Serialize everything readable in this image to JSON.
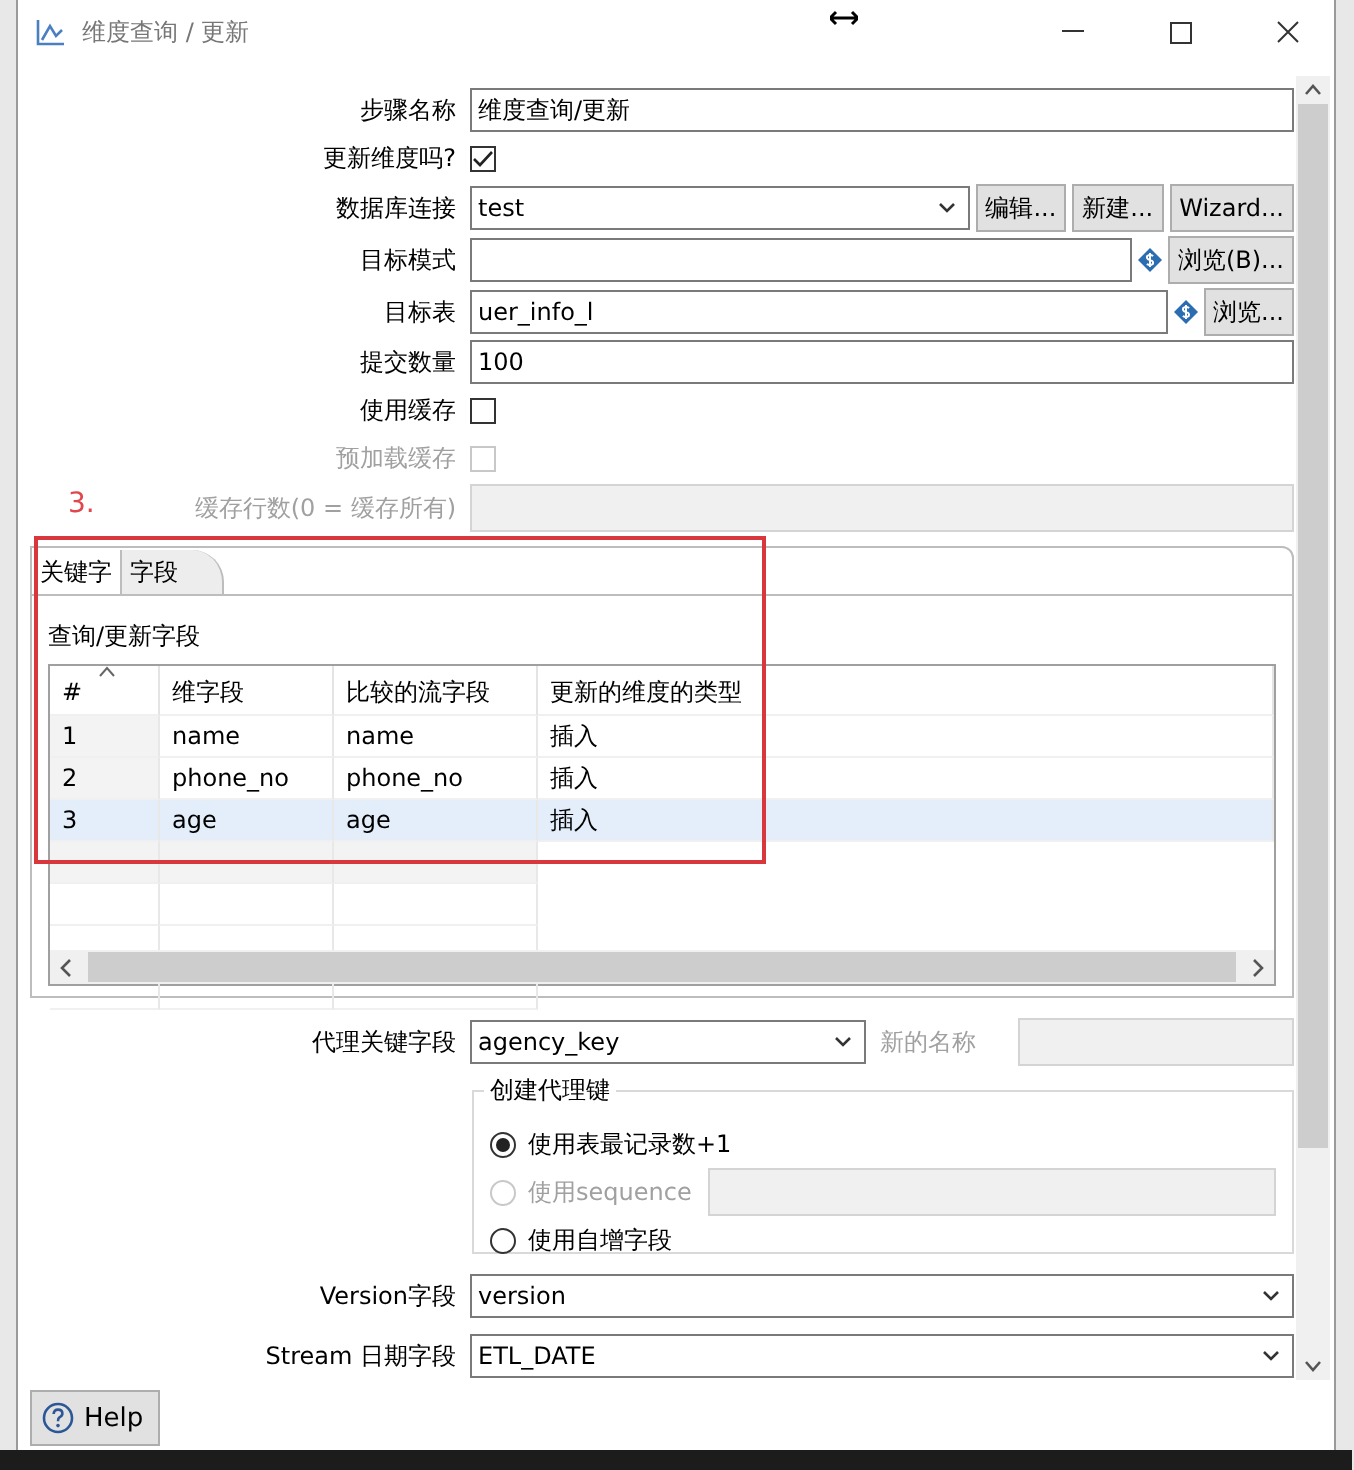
{
  "window": {
    "title": "维度查询 / 更新"
  },
  "annotation": "3.",
  "fields": [
    {
      "kind": "text",
      "label": "步骤名称",
      "value": "维度查询/更新"
    },
    {
      "kind": "checkbox",
      "label": "更新维度吗?",
      "checked": true,
      "disabled": false
    },
    {
      "kind": "combo",
      "label": "数据库连接",
      "value": "test",
      "buttons": [
        "编辑...",
        "新建...",
        "Wizard..."
      ]
    },
    {
      "kind": "text",
      "label": "目标模式",
      "variable": true,
      "buttons": [
        "浏览(B)..."
      ]
    },
    {
      "kind": "text",
      "label": "目标表",
      "value": "uer_info_l",
      "variable": true,
      "buttons": [
        "浏览..."
      ]
    },
    {
      "kind": "text",
      "label": "提交数量",
      "value": "100"
    },
    {
      "kind": "checkbox",
      "label": "使用缓存",
      "checked": false,
      "disabled": false
    },
    {
      "kind": "checkbox",
      "label": "预加载缓存",
      "checked": false,
      "disabled": true
    },
    {
      "kind": "text",
      "label": "缓存行数(0 = 缓存所有)",
      "disabled": true
    }
  ],
  "tabs": [
    {
      "label": "关键字",
      "selected": false
    },
    {
      "label": "字段",
      "selected": true
    }
  ],
  "table": {
    "caption": "查询/更新字段",
    "columns": [
      "#",
      "维字段",
      "比较的流字段",
      "更新的维度的类型"
    ],
    "rows": [
      {
        "cells": [
          "1",
          "name",
          "name",
          "插入"
        ],
        "selected": false
      },
      {
        "cells": [
          "2",
          "phone_no",
          "phone_no",
          "插入"
        ],
        "selected": false
      },
      {
        "cells": [
          "3",
          "age",
          "age",
          "插入"
        ],
        "selected": true
      }
    ]
  },
  "surrogate": {
    "label": "代理关键字段",
    "value": "agency_key",
    "new_name_label": "新的名称"
  },
  "create_key": {
    "title": "创建代理键",
    "options": [
      {
        "kind": "plain",
        "label": "使用表最记录数+1",
        "selected": true,
        "disabled": false
      },
      {
        "kind": "with_field",
        "label": "使用sequence",
        "selected": false,
        "disabled": true
      },
      {
        "kind": "plain",
        "label": "使用自增字段",
        "selected": false,
        "disabled": false
      }
    ]
  },
  "bottom_fields": [
    {
      "label": "Version字段",
      "value": "version"
    },
    {
      "label": "Stream 日期字段",
      "value": "ETL_DATE"
    }
  ],
  "help_button": "Help"
}
